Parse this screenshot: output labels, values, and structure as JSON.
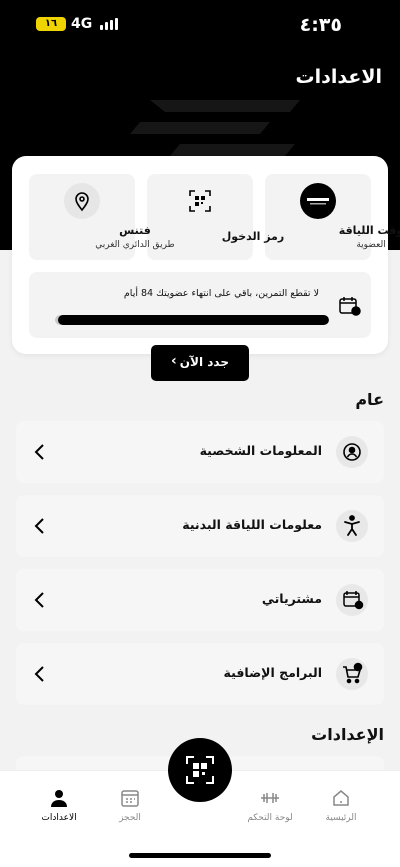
{
  "status": {
    "time": "٤:٣٥",
    "battery": "١٦",
    "network": "4G"
  },
  "header": {
    "title": "الاعدادات"
  },
  "tiles": [
    {
      "title": "وقت اللياقة",
      "subtitle": "العضوية",
      "icon": "gym-logo-icon"
    },
    {
      "title": "رمز الدخول",
      "subtitle": "",
      "icon": "qr-code-icon"
    },
    {
      "title": "فتنس",
      "subtitle": "طريق الدائري الغربي",
      "icon": "location-pin-icon"
    }
  ],
  "membership": {
    "text": "لا تقطع التمرين، باقي على انتهاء عضويتك  84 أيام",
    "progress_fraction": 0.99
  },
  "renew_button": {
    "label": "جدد الآن"
  },
  "general": {
    "section_title": "عام",
    "items": [
      {
        "label": "المعلومات الشخصية",
        "icon": "user-circle-icon"
      },
      {
        "label": "معلومات اللياقة البدنية",
        "icon": "fitness-person-icon"
      },
      {
        "label": "مشترياتي",
        "icon": "calendar-icon"
      },
      {
        "label": "البرامج الإضافية",
        "icon": "cart-add-icon"
      }
    ]
  },
  "settings_section": {
    "title": "الإعدادات"
  },
  "tabbar": {
    "items": [
      {
        "label": "الرئيسية",
        "icon": "home-icon",
        "active": false
      },
      {
        "label": "لوحة التحكم",
        "icon": "dumbbell-icon",
        "active": false
      },
      {
        "label": "الحجز",
        "icon": "calendar-grid-icon",
        "active": false
      },
      {
        "label": "الاعدادات",
        "icon": "person-icon",
        "active": true
      }
    ]
  },
  "colors": {
    "accent": "#000000",
    "background": "#f2f2f2",
    "card": "#ffffff",
    "battery": "#f0d400"
  }
}
